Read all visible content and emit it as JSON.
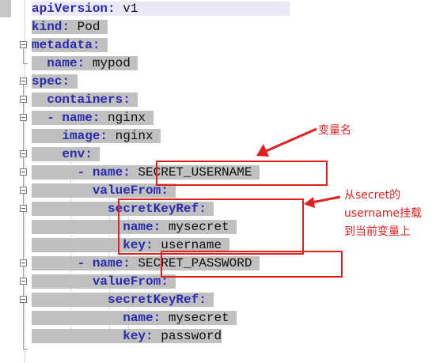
{
  "editor": {
    "lines": [
      {
        "key": "apiVersion",
        "value": "v1"
      },
      {
        "key": "kind",
        "value": "Pod"
      },
      {
        "key": "metadata",
        "value": ""
      },
      {
        "key": "name",
        "value": "mypod"
      },
      {
        "key": "spec",
        "value": ""
      },
      {
        "key": "containers",
        "value": ""
      },
      {
        "prefix": "- ",
        "key": "name",
        "value": "nginx"
      },
      {
        "key": "image",
        "value": "nginx"
      },
      {
        "key": "env",
        "value": ""
      },
      {
        "prefix": "- ",
        "key": "name",
        "value": "SECRET_USERNAME"
      },
      {
        "key": "valueFrom",
        "value": ""
      },
      {
        "key": "secretKeyRef",
        "value": ""
      },
      {
        "key": "name",
        "value": "mysecret"
      },
      {
        "key": "key",
        "value": "username"
      },
      {
        "prefix": "- ",
        "key": "name",
        "value": "SECRET_PASSWORD"
      },
      {
        "key": "valueFrom",
        "value": ""
      },
      {
        "key": "secretKeyRef",
        "value": ""
      },
      {
        "key": "name",
        "value": "mysecret"
      },
      {
        "key": "key",
        "value": "password"
      }
    ]
  },
  "annotations": {
    "var_name": "变量名",
    "mount_line1": "从secret的",
    "mount_line2": "username挂载",
    "mount_line3": "到当前变量上"
  },
  "colors": {
    "annotation": "#e02020",
    "key": "#2b2bb0",
    "selection": "#c0c0c0"
  }
}
